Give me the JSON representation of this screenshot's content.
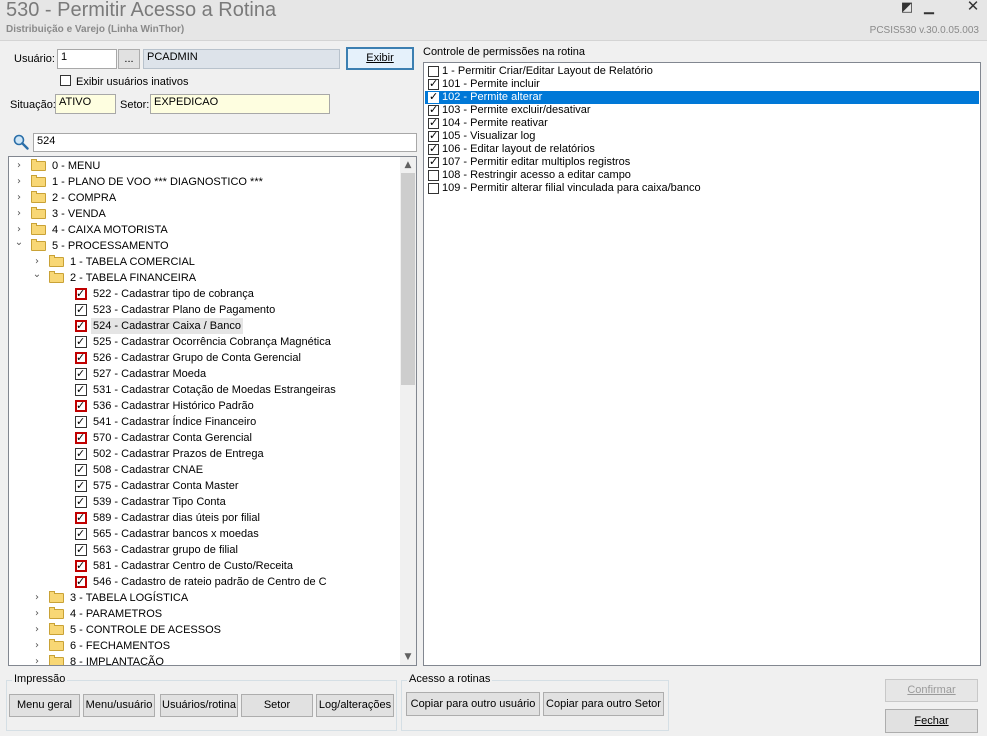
{
  "window": {
    "title": "530 - Permitir Acesso a Rotina",
    "subtitle": "Distribuição e Varejo (Linha WinThor)",
    "version": "PCSIS530  v.30.0.05.003"
  },
  "user": {
    "label": "Usuário:",
    "code": "1",
    "lookup_label": "...",
    "name": "PCADMIN",
    "show_button": "Exibir",
    "show_inactive_label": "Exibir usuários inativos",
    "situation_label": "Situação:",
    "situation_value": "ATIVO",
    "sector_label": "Setor:",
    "sector_value": "EXPEDICAO"
  },
  "search": {
    "value": "524",
    "icon": "search-icon"
  },
  "tree": [
    {
      "level": 0,
      "type": "folder",
      "expanded": false,
      "label": "0 - MENU"
    },
    {
      "level": 0,
      "type": "folder",
      "expanded": false,
      "label": "1 - PLANO DE VOO   *** DIAGNOSTICO ***"
    },
    {
      "level": 0,
      "type": "folder",
      "expanded": false,
      "label": "2 - COMPRA"
    },
    {
      "level": 0,
      "type": "folder",
      "expanded": false,
      "label": "3 - VENDA"
    },
    {
      "level": 0,
      "type": "folder",
      "expanded": false,
      "label": "4 - CAIXA MOTORISTA"
    },
    {
      "level": 0,
      "type": "folder",
      "expanded": true,
      "label": "5 - PROCESSAMENTO"
    },
    {
      "level": 1,
      "type": "folder",
      "expanded": false,
      "label": "1 - TABELA COMERCIAL"
    },
    {
      "level": 1,
      "type": "folder",
      "expanded": true,
      "label": "2 - TABELA FINANCEIRA"
    },
    {
      "level": 2,
      "type": "item",
      "red": true,
      "label": "522 - Cadastrar tipo de cobrança"
    },
    {
      "level": 2,
      "type": "item",
      "red": false,
      "label": "523 - Cadastrar Plano de Pagamento"
    },
    {
      "level": 2,
      "type": "item",
      "red": true,
      "selected": true,
      "label": "524 - Cadastrar Caixa / Banco"
    },
    {
      "level": 2,
      "type": "item",
      "red": false,
      "label": "525 - Cadastrar Ocorrência Cobrança Magnética"
    },
    {
      "level": 2,
      "type": "item",
      "red": true,
      "label": "526 - Cadastrar Grupo de Conta Gerencial"
    },
    {
      "level": 2,
      "type": "item",
      "red": false,
      "label": "527 - Cadastrar Moeda"
    },
    {
      "level": 2,
      "type": "item",
      "red": false,
      "label": "531 - Cadastrar Cotação de Moedas Estrangeiras"
    },
    {
      "level": 2,
      "type": "item",
      "red": true,
      "label": "536 - Cadastrar Histórico Padrão"
    },
    {
      "level": 2,
      "type": "item",
      "red": false,
      "label": "541 - Cadastrar Índice Financeiro"
    },
    {
      "level": 2,
      "type": "item",
      "red": true,
      "label": "570 - Cadastrar Conta Gerencial"
    },
    {
      "level": 2,
      "type": "item",
      "red": false,
      "label": "502 - Cadastrar Prazos de Entrega"
    },
    {
      "level": 2,
      "type": "item",
      "red": false,
      "label": "508 - Cadastrar CNAE"
    },
    {
      "level": 2,
      "type": "item",
      "red": false,
      "label": "575 - Cadastrar Conta Master"
    },
    {
      "level": 2,
      "type": "item",
      "red": false,
      "label": "539 - Cadastrar Tipo Conta"
    },
    {
      "level": 2,
      "type": "item",
      "red": true,
      "label": "589 - Cadastrar dias úteis por filial"
    },
    {
      "level": 2,
      "type": "item",
      "red": false,
      "label": "565 - Cadastrar bancos x moedas"
    },
    {
      "level": 2,
      "type": "item",
      "red": false,
      "label": "563 - Cadastrar grupo de filial"
    },
    {
      "level": 2,
      "type": "item",
      "red": true,
      "label": "581 - Cadastrar Centro de Custo/Receita"
    },
    {
      "level": 2,
      "type": "item",
      "red": true,
      "label": "546 - Cadastro de rateio padrão de Centro de C"
    },
    {
      "level": 1,
      "type": "folder",
      "expanded": false,
      "label": "3 - TABELA LOGÍSTICA"
    },
    {
      "level": 1,
      "type": "folder",
      "expanded": false,
      "label": "4 - PARAMETROS"
    },
    {
      "level": 1,
      "type": "folder",
      "expanded": false,
      "label": "5 - CONTROLE DE ACESSOS"
    },
    {
      "level": 1,
      "type": "folder",
      "expanded": false,
      "label": "6 - FECHAMENTOS"
    },
    {
      "level": 1,
      "type": "folder",
      "expanded": false,
      "label": "8 - IMPLANTAÇÃO"
    }
  ],
  "permissions": {
    "title": "Controle de permissões na rotina",
    "items": [
      {
        "label": "1 - Permitir Criar/Editar Layout de Relatório",
        "checked": false
      },
      {
        "label": "101 - Permite incluir",
        "checked": true
      },
      {
        "label": "102 - Permite alterar",
        "checked": true,
        "selected": true
      },
      {
        "label": "103 - Permite excluir/desativar",
        "checked": true
      },
      {
        "label": "104 - Permite reativar",
        "checked": true
      },
      {
        "label": "105 - Visualizar log",
        "checked": true
      },
      {
        "label": "106 - Editar layout de relatórios",
        "checked": true
      },
      {
        "label": "107 - Permitir editar multiplos registros",
        "checked": true
      },
      {
        "label": "108 - Restringir acesso a editar campo",
        "checked": false
      },
      {
        "label": "109 - Permitir alterar filial vinculada para caixa/banco",
        "checked": false
      }
    ]
  },
  "impressao": {
    "title": "Impressão",
    "buttons": [
      "Menu geral",
      "Menu/usuário",
      "Usuários/rotina",
      "Setor",
      "Log/alterações"
    ]
  },
  "acesso": {
    "title": "Acesso a rotinas",
    "buttons": [
      "Copiar para outro usuário",
      "Copiar para outro Setor"
    ]
  },
  "actions": {
    "confirm": "Confirmar",
    "close": "Fechar"
  }
}
